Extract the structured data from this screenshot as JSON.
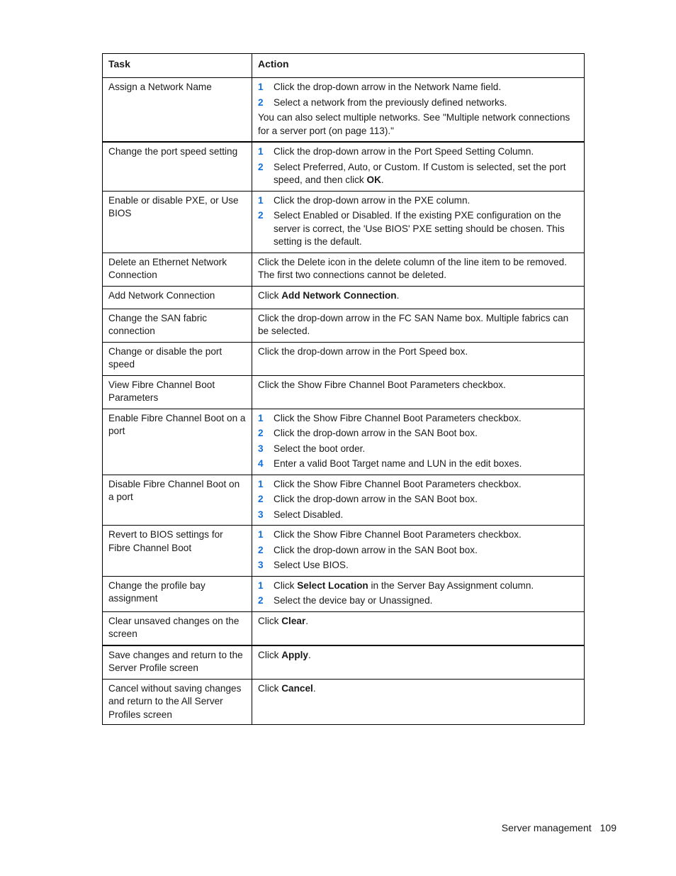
{
  "table": {
    "headers": {
      "task": "Task",
      "action": "Action"
    },
    "rows": [
      {
        "task": "Assign a Network Name",
        "steps": [
          {
            "num": "1",
            "text": "Click the drop-down arrow in the Network Name field."
          },
          {
            "num": "2",
            "text": "Select a network from the previously defined networks."
          }
        ],
        "note": "You can also select multiple networks. See \"Multiple network connections for a server port (on page 113).\""
      },
      {
        "task": "Change the port speed setting",
        "steps": [
          {
            "num": "1",
            "text": "Click the drop-down arrow in the Port Speed Setting Column."
          },
          {
            "num": "2",
            "text": "Select Preferred, Auto, or Custom. If Custom is selected, set the port speed, and then click ",
            "bold": "OK",
            "after": "."
          }
        ]
      },
      {
        "task": "Enable or disable PXE, or Use BIOS",
        "steps": [
          {
            "num": "1",
            "text": "Click the drop-down arrow in the PXE column."
          },
          {
            "num": "2",
            "text": "Select Enabled or Disabled. If the existing PXE configuration on the server is correct, the 'Use BIOS' PXE setting should be chosen. This setting is the default."
          }
        ]
      },
      {
        "task": "Delete an Ethernet Network Connection",
        "action": "Click the Delete icon in the delete column of the line item to be removed. The first two connections cannot be deleted."
      },
      {
        "task": "Add Network Connection",
        "action": "Click ",
        "action_bold": "Add Network Connection",
        "action_after": "."
      },
      {
        "task": "Change the SAN fabric connection",
        "action": "Click the drop-down arrow in the FC SAN Name box. Multiple fabrics can be selected."
      },
      {
        "task": "Change or disable the port speed",
        "action": "Click the drop-down arrow in the Port Speed box."
      },
      {
        "task": "View Fibre Channel Boot Parameters",
        "action": "Click the Show Fibre Channel Boot Parameters checkbox."
      },
      {
        "task": "Enable Fibre Channel Boot on a port",
        "steps": [
          {
            "num": "1",
            "text": "Click the Show Fibre Channel Boot Parameters checkbox."
          },
          {
            "num": "2",
            "text": "Click the drop-down arrow in the SAN Boot box."
          },
          {
            "num": "3",
            "text": "Select the boot order."
          },
          {
            "num": "4",
            "text": "Enter a valid Boot Target name and LUN in the edit boxes."
          }
        ]
      },
      {
        "task": "Disable Fibre Channel Boot on a port",
        "steps": [
          {
            "num": "1",
            "text": "Click the Show Fibre Channel Boot Parameters checkbox."
          },
          {
            "num": "2",
            "text": "Click the drop-down arrow in the SAN Boot box."
          },
          {
            "num": "3",
            "text": "Select Disabled."
          }
        ]
      },
      {
        "task": "Revert to BIOS settings for Fibre Channel Boot",
        "steps": [
          {
            "num": "1",
            "text": "Click the Show Fibre Channel Boot Parameters checkbox."
          },
          {
            "num": "2",
            "text": "Click the drop-down arrow in the SAN Boot box."
          },
          {
            "num": "3",
            "text": "Select Use BIOS."
          }
        ]
      },
      {
        "task": "Change the profile bay assignment",
        "steps": [
          {
            "num": "1",
            "text": "Click ",
            "bold": "Select Location",
            "after": " in the Server Bay Assignment column."
          },
          {
            "num": "2",
            "text": "Select the device bay or Unassigned."
          }
        ]
      },
      {
        "task": "Clear unsaved changes on the screen",
        "action": "Click ",
        "action_bold": "Clear",
        "action_after": "."
      },
      {
        "task": "Save changes and return to the Server Profile screen",
        "action": "Click ",
        "action_bold": "Apply",
        "action_after": "."
      },
      {
        "task": "Cancel without saving changes and return to the All Server Profiles screen",
        "action": "Click ",
        "action_bold": "Cancel",
        "action_after": "."
      }
    ]
  },
  "footer": {
    "section": "Server management",
    "page_number": "109"
  },
  "colors": {
    "step_number": "#0f6fe0",
    "border": "#000000"
  }
}
